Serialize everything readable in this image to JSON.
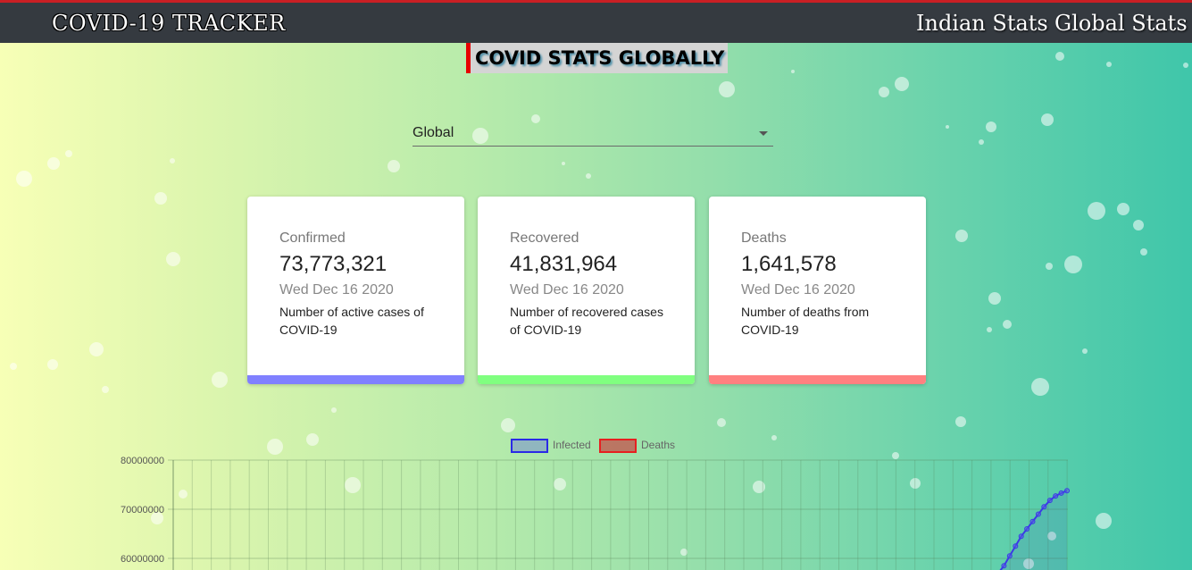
{
  "nav": {
    "brand": "COVID-19 TRACKER",
    "links": [
      "Indian Stats",
      "Global Stats"
    ]
  },
  "page": {
    "heading": "COVID STATS GLOBALLY"
  },
  "selector": {
    "value": "Global"
  },
  "cards": [
    {
      "label": "Confirmed",
      "value": "73,773,321",
      "date": "Wed Dec 16 2020",
      "desc": "Number of active cases of COVID-19",
      "color": "#8080ff"
    },
    {
      "label": "Recovered",
      "value": "41,831,964",
      "date": "Wed Dec 16 2020",
      "desc": "Number of recovered cases of COVID-19",
      "color": "#80ff80"
    },
    {
      "label": "Deaths",
      "value": "1,641,578",
      "date": "Wed Dec 16 2020",
      "desc": "Number of deaths from COVID-19",
      "color": "#ff8080"
    }
  ],
  "colors": {
    "navbar": "#353a40",
    "accent_red": "#e60000",
    "infected_line": "#3a3ae6",
    "deaths_line": "#e62020"
  },
  "chart_data": {
    "type": "line",
    "legend": [
      "Infected",
      "Deaths"
    ],
    "legend_placement": "top-center",
    "yticks": [
      "80000000",
      "70000000",
      "60000000"
    ],
    "ylim_visible": [
      57000000,
      80000000
    ],
    "grid": true,
    "series": [
      {
        "name": "Infected",
        "color": "#3a3ae6",
        "values": [
          57000000,
          58500000,
          60500000,
          62500000,
          64500000,
          66000000,
          67500000,
          69000000,
          70500000,
          71800000,
          72700000,
          73300000,
          73773321
        ]
      },
      {
        "name": "Deaths",
        "color": "#e62020",
        "values": []
      }
    ]
  }
}
